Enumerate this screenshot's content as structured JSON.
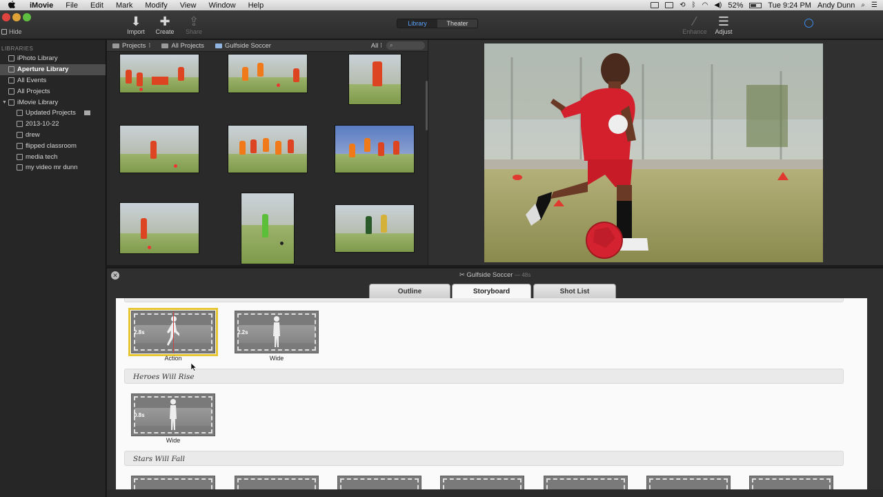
{
  "menubar": {
    "app": "iMovie",
    "items": [
      "File",
      "Edit",
      "Mark",
      "Modify",
      "View",
      "Window",
      "Help"
    ],
    "battery": "52%",
    "clock": "Tue 9:24 PM",
    "user": "Andy Dunn"
  },
  "toolbar": {
    "hide_label": "Hide",
    "import_label": "Import",
    "create_label": "Create",
    "share_label": "Share",
    "library_label": "Library",
    "theater_label": "Theater",
    "enhance_label": "Enhance",
    "adjust_label": "Adjust"
  },
  "sidebar": {
    "header": "LIBRARIES",
    "items": [
      {
        "label": "iPhoto Library"
      },
      {
        "label": "Aperture Library"
      },
      {
        "label": "All Events"
      },
      {
        "label": "All Projects"
      },
      {
        "label": "iMovie Library"
      },
      {
        "label": "Updated Projects"
      },
      {
        "label": "2013-10-22"
      },
      {
        "label": "drew"
      },
      {
        "label": "flipped classroom"
      },
      {
        "label": "media tech"
      },
      {
        "label": "my video mr dunn"
      }
    ]
  },
  "browser": {
    "crumb1": "Projects",
    "crumb2": "All Projects",
    "crumb3": "Gulfside Soccer",
    "filter": "All",
    "search_placeholder": ""
  },
  "project": {
    "title": "Gulfside Soccer",
    "duration": "48s"
  },
  "tabs": {
    "outline": "Outline",
    "storyboard": "Storyboard",
    "shotlist": "Shot List"
  },
  "storyboard": {
    "shots_top": [
      {
        "dur": "2.8s",
        "label": "Action"
      },
      {
        "dur": "2.2s",
        "label": "Wide"
      }
    ],
    "section1": "Heroes Will Rise",
    "shots_mid": [
      {
        "dur": "0.8s",
        "label": "Wide"
      }
    ],
    "section2": "Stars Will Fall"
  },
  "colors": {
    "accent": "#5aa4ff",
    "selection": "#e7c634",
    "jersey_red": "#d4202c",
    "jersey_orange": "#f07a1a"
  }
}
